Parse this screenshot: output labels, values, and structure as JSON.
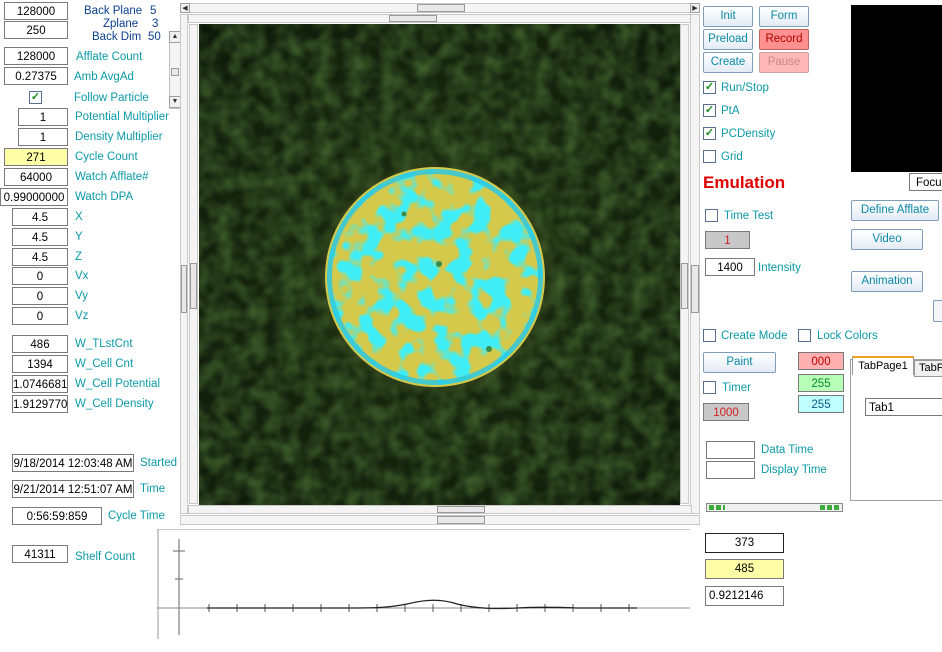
{
  "top_info": {
    "field1": "128000",
    "field2": "250",
    "back_plane_label": "Back Plane",
    "back_plane_value": "5",
    "zplane_label": "Zplane",
    "zplane_value": "3",
    "back_dim_label": "Back Dim",
    "back_dim_value": "50"
  },
  "params": [
    {
      "value": "128000",
      "label": "Afflate Count"
    },
    {
      "value": "0.27375",
      "label": "Amb AvgAd"
    }
  ],
  "follow_particle": {
    "label": "Follow Particle",
    "checked": true
  },
  "params2": [
    {
      "value": "1",
      "label": "Potential Multiplier"
    },
    {
      "value": "1",
      "label": "Density Multiplier"
    },
    {
      "value": "271",
      "label": "Cycle Count"
    },
    {
      "value": "64000",
      "label": "Watch Afflate#"
    },
    {
      "value": "0.99000000",
      "label": "Watch DPA"
    }
  ],
  "coords": [
    {
      "value": "4.5",
      "label": "X"
    },
    {
      "value": "4.5",
      "label": "Y"
    },
    {
      "value": "4.5",
      "label": "Z"
    },
    {
      "value": "0",
      "label": "Vx"
    },
    {
      "value": "0",
      "label": "Vy"
    },
    {
      "value": "0",
      "label": "Vz"
    }
  ],
  "cells": [
    {
      "value": "486",
      "label": "W_TLstCnt"
    },
    {
      "value": "1394",
      "label": "W_Cell Cnt"
    },
    {
      "value": "1.0746681",
      "label": "W_Cell Potential"
    },
    {
      "value": "1.9129770",
      "label": "W_Cell Density"
    }
  ],
  "times": {
    "started_value": "9/18/2014 12:03:48 AM",
    "started_label": "Started",
    "time_value": "9/21/2014 12:51:07 AM",
    "time_label": "Time",
    "cycle_value": "0:56:59:859",
    "cycle_label": "Cycle Time",
    "shelf_value": "41311",
    "shelf_label": "Shelf Count"
  },
  "buttons": {
    "init": "Init",
    "form": "Form",
    "preload": "Preload",
    "record": "Record",
    "create": "Create",
    "pause": "Pause",
    "define_afflate": "Define Afflate",
    "video": "Video",
    "animation": "Animation",
    "paint": "Paint"
  },
  "checks": {
    "run_stop": "Run/Stop",
    "pta": "PtA",
    "pcdensity": "PCDensity",
    "grid": "Grid",
    "time_test": "Time Test",
    "create_mode": "Create Mode",
    "lock_colors": "Lock Colors",
    "timer": "Timer"
  },
  "emulation_title": "Emulation",
  "intensity": {
    "field1": "1",
    "value": "1400",
    "label": "Intensity"
  },
  "timer_value": "1000",
  "colors": {
    "red_value": "000",
    "green_value": "255",
    "blue_value": "255"
  },
  "data_time": {
    "data_label": "Data Time",
    "display_label": "Display Time",
    "data_value": "",
    "display_value": ""
  },
  "bottom_right": {
    "v1": "373",
    "v2": "485",
    "v3": "0.9212146"
  },
  "preview": {
    "caption": "Focus"
  },
  "tabs": {
    "tab1": "TabPage1",
    "tab2": "TabP",
    "textbox": "Tab1"
  },
  "palette": {
    "teal_label": "#0b9aa8",
    "red_text": "#e00000",
    "yellow_bg": "#ffffa8",
    "pink_bg": "#ffb0b0",
    "green_bg": "#b8ffb8",
    "cyan_bg": "#c0ffff",
    "gray_bg": "#c8c8c8"
  }
}
